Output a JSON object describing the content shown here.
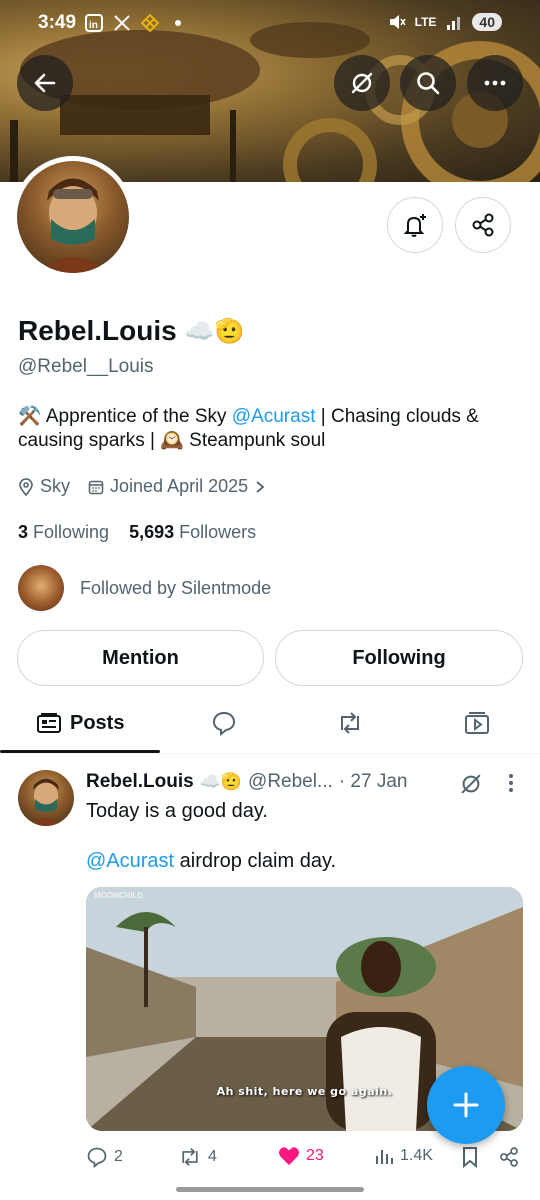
{
  "status_bar": {
    "time": "3:49",
    "left_icons": [
      "linkedin-icon",
      "x-icon",
      "binance-icon",
      "dot-icon"
    ],
    "network": "LTE",
    "battery": "40"
  },
  "profile": {
    "display_name": "Rebel.Louis",
    "name_emojis": "☁️🫡",
    "handle": "@Rebel__Louis",
    "bio": {
      "prefix": "⚒️ Apprentice of the Sky ",
      "mention": "@Acurast",
      "suffix": " | Chasing clouds & causing sparks | 🕰️ Steampunk soul"
    },
    "location": "Sky",
    "joined": "Joined April 2025",
    "following_count": "3",
    "following_label": "Following",
    "followers_count": "5,693",
    "followers_label": "Followers",
    "followed_by": "Followed by Silentmode"
  },
  "buttons": {
    "mention": "Mention",
    "following": "Following"
  },
  "tabs": {
    "posts": "Posts"
  },
  "post": {
    "name": "Rebel.Louis",
    "emojis": "☁️🫡",
    "handle": "@Rebel...",
    "time": "· 27 Jan",
    "line1": "Today is a good day.",
    "mention": "@Acurast",
    "line2_rest": " airdrop claim day.",
    "media_caption": "Ah shit, here we go again.",
    "media_watermark": "MOONCHILD",
    "replies": "2",
    "reposts": "4",
    "likes": "23",
    "views": "1.4K"
  },
  "colors": {
    "accent": "#1d9bf0",
    "like": "#f91880",
    "secondary_text": "#536471"
  }
}
